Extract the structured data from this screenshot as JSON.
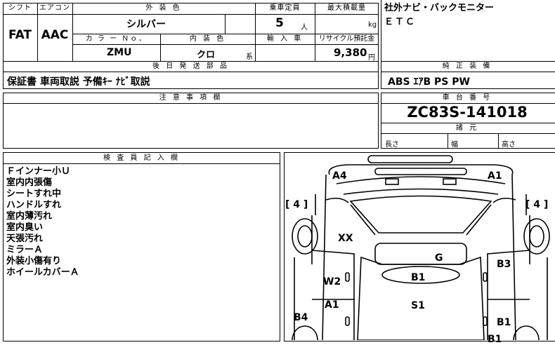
{
  "header_labels": {
    "shift": "シフト",
    "aircon": "エアコン",
    "exterior_color": "外 装 色",
    "capacity": "乗車定員",
    "max_load": "最大積載量",
    "color_no": "カ ラ ー Ｎｏ．",
    "interior_color": "内 装 色",
    "import": "輸 入 車",
    "recycle": "リサイクル預託金",
    "later_parts": "後 日 発 送 部 品",
    "genuine_equipment": "純 正 装 備",
    "notes": "注 意 事 項 欄",
    "chassis_no": "車 台 番 号",
    "specs": "諸 元",
    "inspector_notes": "検 査 員 記 入 欄"
  },
  "values": {
    "shift": "FAT",
    "aircon": "AAC",
    "exterior_color": "シルバー",
    "capacity": "5",
    "capacity_unit": "人",
    "max_load_unit": "kg",
    "color_no": "ZMU",
    "interior_color": "クロ",
    "interior_suffix": "系",
    "recycle_fee": "9,380",
    "recycle_unit": "円",
    "later_parts": "保証書 車両取説 予備ｷｰ ﾅﾋﾞ取説",
    "genuine_equipment": "ABS ｴｱB PS PW",
    "chassis_no": "ZC83S-141018"
  },
  "equipment_lines": [
    "社外ナビ・バックモニター",
    "ＥＴＣ"
  ],
  "specs": {
    "length": "長さ",
    "width": "幅",
    "height": "高さ"
  },
  "inspector_notes": [
    "Ｆインナー小Ｕ",
    "室内内張傷",
    "シートすれ中",
    "ハンドルすれ",
    "室内薄汚れ",
    "室内臭い",
    "天張汚れ",
    "ミラーＡ",
    "外装小傷有り",
    "ホイールカバーＡ"
  ],
  "diagram": {
    "tire_left": "[ 4 ]",
    "tire_right": "[ 4 ]",
    "marks": {
      "a4": "A4",
      "a1_top": "A1",
      "xx": "XX",
      "g": "G",
      "b3": "B3",
      "w2": "W2",
      "b1_center": "B1",
      "a1_lower": "A1",
      "s1": "S1",
      "b4": "B4",
      "b1_right": "B1",
      "b1_bottom": "B1"
    }
  }
}
